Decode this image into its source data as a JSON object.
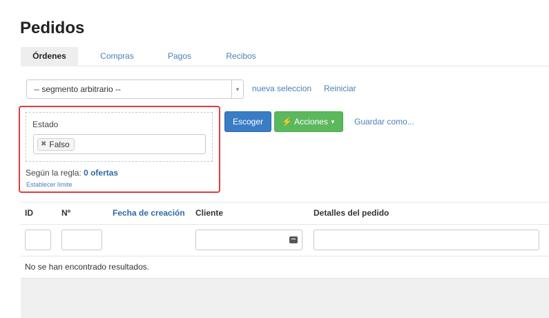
{
  "page": {
    "title": "Pedidos"
  },
  "tabs": [
    {
      "label": "Órdenes",
      "active": true
    },
    {
      "label": "Compras",
      "active": false
    },
    {
      "label": "Pagos",
      "active": false
    },
    {
      "label": "Recibos",
      "active": false
    }
  ],
  "segment": {
    "selected": "-- segmento arbitrario --",
    "new_selection_link": "nueva seleccion",
    "reset_link": "Reiniciar"
  },
  "filter": {
    "label": "Estado",
    "tags": [
      {
        "label": "Falso"
      }
    ],
    "rule_prefix": "Según la regla:",
    "rule_count": "0 ofertas",
    "limit_link": "Establecer límite"
  },
  "actions": {
    "choose_label": "Escoger",
    "actions_label": "Acciones",
    "save_as_link": "Guardar como..."
  },
  "table": {
    "columns": [
      {
        "label": "ID",
        "sortable": false
      },
      {
        "label": "Nº",
        "sortable": false
      },
      {
        "label": "Fecha de creación",
        "sortable": true
      },
      {
        "label": "Cliente",
        "sortable": false
      },
      {
        "label": "Detalles del pedido",
        "sortable": false
      }
    ],
    "empty_message": "No se han encontrado resultados."
  },
  "colors": {
    "primary": "#3b7dc4",
    "success": "#5cb85c",
    "link": "#4a7fb5",
    "highlight_border": "#e03b3b"
  }
}
